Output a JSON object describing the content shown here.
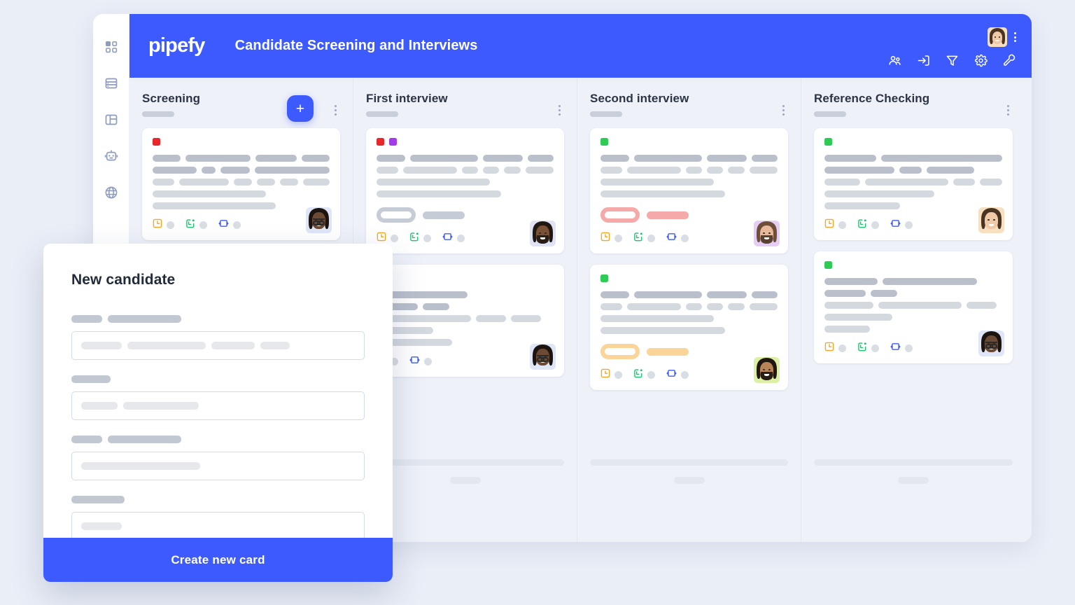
{
  "app": {
    "logo_text": "pipefy",
    "board_title": "Candidate Screening and Interviews",
    "brand_color": "#3d5afe",
    "page_bg": "#eaeef7",
    "board_bg": "#eef1f8"
  },
  "sidebar": {
    "items": [
      {
        "icon": "dashboard-grid-icon",
        "label": ""
      },
      {
        "icon": "database-icon",
        "label": ""
      },
      {
        "icon": "layout-panel-icon",
        "label": ""
      },
      {
        "icon": "robot-automation-icon",
        "label": ""
      },
      {
        "icon": "globe-icon",
        "label": ""
      }
    ]
  },
  "topbar": {
    "avatar": {
      "icon": "user-avatar",
      "alt": "Account avatar"
    },
    "kebab": {
      "icon": "kebab-menu-icon"
    },
    "icons": [
      {
        "icon": "members-people-icon",
        "label": "Members"
      },
      {
        "icon": "import-inbox-icon",
        "label": "Import"
      },
      {
        "icon": "filter-funnel-icon",
        "label": "Filter"
      },
      {
        "icon": "settings-gear-icon",
        "label": "Settings"
      },
      {
        "icon": "wrench-tools-icon",
        "label": "Tools"
      }
    ]
  },
  "board": {
    "add_button_label": "+",
    "columns": [
      {
        "title": "Screening",
        "kebab_icon": "kebab-menu-icon",
        "has_add_button": true,
        "cards": [
          {
            "tags": [
              "#e8282b"
            ],
            "lines": [
              {
                "tone": "dark",
                "widths": [
                  30,
                  70,
                  44,
                  30
                ]
              },
              {
                "tone": "dark",
                "widths": [
                  37,
                  12,
                  25,
                  63
                ]
              },
              {
                "tone": "light",
                "widths": [
                  26,
                  60,
                  22,
                  22,
                  22,
                  32
                ]
              },
              {
                "tone": "light",
                "widths": [
                  60
                ]
              },
              {
                "tone": "light",
                "widths": [
                  65
                ]
              }
            ],
            "badge": null,
            "icons": [
              "clock-orange-icon",
              "calendar-green-icon",
              "loop-blue-icon"
            ],
            "avatar": "avatar-glasses-man"
          }
        ],
        "footer": {
          "bar": true,
          "pill": true
        }
      },
      {
        "title": "First interview",
        "kebab_icon": "kebab-menu-icon",
        "has_add_button": false,
        "cards": [
          {
            "tags": [
              "#e8282b",
              "#a23ce8"
            ],
            "lines": [
              {
                "tone": "dark",
                "widths": [
                  30,
                  72,
                  42,
                  27
                ]
              },
              {
                "tone": "light",
                "widths": [
                  25,
                  62,
                  18,
                  19,
                  19,
                  32
                ]
              },
              {
                "tone": "light",
                "widths": [
                  60
                ]
              },
              {
                "tone": "light",
                "widths": [
                  66
                ]
              }
            ],
            "badge": {
              "style": "gray",
              "hollow_color": "#c6ccd6",
              "solid_color": "#c6ccd6"
            },
            "icons": [
              "clock-orange-icon",
              "calendar-green-icon",
              "loop-blue-icon"
            ],
            "avatar": "avatar-beard-man"
          },
          {
            "tags": [],
            "lines": [
              {
                "tone": "dark",
                "widths": [
                  48
                ]
              },
              {
                "tone": "dark",
                "widths": [
                  22,
                  14
                ]
              },
              {
                "tone": "light",
                "widths": [
                  50,
                  16,
                  16
                ]
              },
              {
                "tone": "light",
                "widths": [
                  30
                ]
              },
              {
                "tone": "light",
                "widths": [
                  40
                ]
              }
            ],
            "badge": null,
            "icons": [
              "calendar-green-icon",
              "loop-blue-icon"
            ],
            "avatar": "avatar-glasses-man"
          }
        ],
        "footer": {
          "bar": true,
          "pill": true
        }
      },
      {
        "title": "Second interview",
        "kebab_icon": "kebab-menu-icon",
        "has_add_button": false,
        "cards": [
          {
            "tags": [
              "#2ecc56"
            ],
            "lines": [
              {
                "tone": "dark",
                "widths": [
                  30,
                  72,
                  42,
                  27
                ]
              },
              {
                "tone": "light",
                "widths": [
                  25,
                  62,
                  18,
                  19,
                  19,
                  32
                ]
              },
              {
                "tone": "light",
                "widths": [
                  60
                ]
              },
              {
                "tone": "light",
                "widths": [
                  66
                ]
              }
            ],
            "badge": {
              "style": "red",
              "hollow_color": "#f6a9a9",
              "solid_color": "#f6a9a9"
            },
            "icons": [
              "clock-orange-icon",
              "calendar-green-icon",
              "loop-blue-icon"
            ],
            "avatar": "avatar-pink-man"
          },
          {
            "tags": [
              "#2ecc56"
            ],
            "lines": [
              {
                "tone": "dark",
                "widths": [
                  30,
                  72,
                  42,
                  27
                ]
              },
              {
                "tone": "light",
                "widths": [
                  25,
                  62,
                  18,
                  19,
                  19,
                  32
                ]
              },
              {
                "tone": "light",
                "widths": [
                  60
                ]
              },
              {
                "tone": "light",
                "widths": [
                  66
                ]
              }
            ],
            "badge": {
              "style": "amber",
              "hollow_color": "#fbd49a",
              "solid_color": "#fbd49a"
            },
            "icons": [
              "clock-orange-icon",
              "calendar-green-icon",
              "loop-blue-icon"
            ],
            "avatar": "avatar-green-man"
          }
        ],
        "footer": {
          "bar": true,
          "pill": true
        }
      },
      {
        "title": "Reference Checking",
        "kebab_icon": "kebab-menu-icon",
        "has_add_button": false,
        "cards": [
          {
            "tags": [
              "#2ecc56"
            ],
            "lines": [
              {
                "tone": "dark",
                "widths": [
                  30,
                  70
                ]
              },
              {
                "tone": "dark",
                "widths": [
                  37,
                  12,
                  25
                ]
              },
              {
                "tone": "light",
                "widths": [
                  26,
                  60,
                  16,
                  16
                ]
              },
              {
                "tone": "light",
                "widths": [
                  58
                ]
              },
              {
                "tone": "light",
                "widths": [
                  40
                ]
              }
            ],
            "badge": null,
            "icons": [
              "clock-orange-icon",
              "calendar-green-icon",
              "loop-blue-icon"
            ],
            "avatar": "avatar-woman"
          },
          {
            "tags": [
              "#2ecc56"
            ],
            "lines": [
              {
                "tone": "dark",
                "widths": [
                  28,
                  50
                ]
              },
              {
                "tone": "dark",
                "widths": [
                  22,
                  14
                ]
              },
              {
                "tone": "light",
                "widths": [
                  26,
                  44,
                  16
                ]
              },
              {
                "tone": "light",
                "widths": [
                  36
                ]
              },
              {
                "tone": "light",
                "widths": [
                  24
                ]
              }
            ],
            "badge": null,
            "icons": [
              "clock-orange-icon",
              "calendar-green-icon",
              "loop-blue-icon"
            ],
            "avatar": "avatar-glasses-man"
          }
        ],
        "footer": {
          "bar": true,
          "pill": true
        }
      }
    ]
  },
  "modal": {
    "title": "New candidate",
    "cta_label": "Create new card",
    "fields": [
      {
        "label_widths": [
          44,
          105
        ],
        "value_widths": [
          58,
          112,
          62,
          42
        ]
      },
      {
        "label_widths": [
          56
        ],
        "value_widths": [
          52,
          108
        ]
      },
      {
        "label_widths": [
          44,
          105
        ],
        "value_widths": [
          170
        ]
      },
      {
        "label_widths": [
          76
        ],
        "value_widths": [
          58
        ]
      }
    ]
  }
}
